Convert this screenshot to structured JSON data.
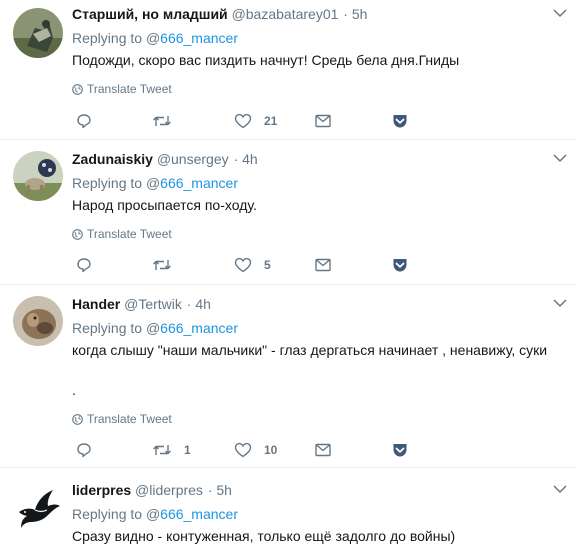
{
  "icons": {
    "reply": "reply-icon",
    "retweet": "retweet-icon",
    "like": "heart-icon",
    "message": "envelope-icon",
    "save": "pocket-icon",
    "translate": "globe-icon",
    "caret": "chevron-down-icon"
  },
  "colors": {
    "link": "#1b95e0",
    "muted": "#657786",
    "save": "#3d5a78"
  },
  "replying_label": "Replying to",
  "translate_label": "Translate Tweet",
  "tweets": [
    {
      "name": "Старший, но младший",
      "handle": "@bazabatarey01",
      "time": "· 5h",
      "reply_to_at": "@",
      "reply_to_user": "666_mancer",
      "text": "Подожди, скоро вас пиздить начнут! Средь бела дня.Гниды",
      "retweets": "",
      "likes": "21"
    },
    {
      "name": "Zadunaiskiy",
      "handle": "@unsergey",
      "time": "· 4h",
      "reply_to_at": "@",
      "reply_to_user": "666_mancer",
      "text": "Народ просыпается по-ходу.",
      "retweets": "",
      "likes": "5"
    },
    {
      "name": "Hander",
      "handle": "@Tertwik",
      "time": "· 4h",
      "reply_to_at": "@",
      "reply_to_user": "666_mancer",
      "text": "когда слышу \"наши мальчики\" - глаз дергаться начинает , ненавижу, суки",
      "text2": ".",
      "retweets": "1",
      "likes": "10"
    },
    {
      "name": "liderpres",
      "handle": "@liderpres",
      "time": "· 5h",
      "reply_to_at": "@",
      "reply_to_user": "666_mancer",
      "text": "Сразу видно - контуженная, только ещё задолго до войны)"
    }
  ]
}
